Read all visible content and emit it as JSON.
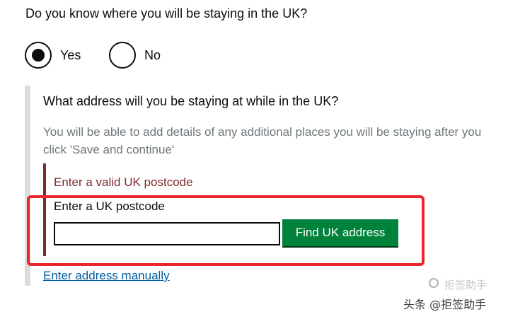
{
  "question": "Do you know where you will be staying in the UK?",
  "radios": [
    {
      "label": "Yes",
      "checked": true
    },
    {
      "label": "No",
      "checked": false
    }
  ],
  "conditional": {
    "question": "What address will you be staying at while in the UK?",
    "hint": "You will be able to add details of any additional places you will be staying after you click 'Save and continue'",
    "error_message": "Enter a valid UK postcode",
    "postcode_label": "Enter a UK postcode",
    "postcode_value": "",
    "find_button_label": "Find UK address",
    "manual_link": "Enter address manually"
  },
  "watermark": {
    "text": "头条 @拒签助手",
    "faded_text": "拒签助手"
  },
  "colors": {
    "text": "#0b0c0c",
    "hint": "#6f777b",
    "error": "#7d2a2f",
    "button": "#00823b",
    "link": "#005ea5",
    "highlight": "#e8262b"
  }
}
